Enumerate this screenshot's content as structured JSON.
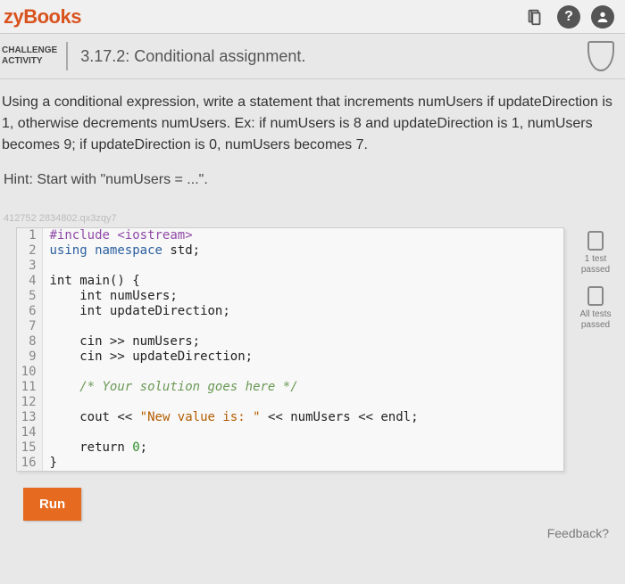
{
  "brand": "zyBooks",
  "header": {
    "challenge_label_line1": "CHALLENGE",
    "challenge_label_line2": "ACTIVITY",
    "title": "3.17.2: Conditional assignment."
  },
  "instructions": "Using a conditional expression, write a statement that increments numUsers if updateDirection is 1, otherwise decrements numUsers. Ex: if numUsers is 8 and updateDirection is 1, numUsers becomes 9; if updateDirection is 0, numUsers becomes 7.",
  "hint": "Hint: Start with \"numUsers = ...\".",
  "qid": "412752 2834802.qx3zqy7",
  "code": {
    "lines": [
      {
        "n": "1",
        "t": "#include <iostream>",
        "cls": "pp"
      },
      {
        "n": "2",
        "t_pre": "using namespace ",
        "t_mid": "std",
        "t_post": ";"
      },
      {
        "n": "3",
        "t": ""
      },
      {
        "n": "4",
        "t": "int main() {"
      },
      {
        "n": "5",
        "t": "    int numUsers;"
      },
      {
        "n": "6",
        "t": "    int updateDirection;"
      },
      {
        "n": "7",
        "t": ""
      },
      {
        "n": "8",
        "t": "    cin >> numUsers;"
      },
      {
        "n": "9",
        "t": "    cin >> updateDirection;"
      },
      {
        "n": "10",
        "t": ""
      },
      {
        "n": "11",
        "t": "    /* Your solution goes here */",
        "cls": "cm"
      },
      {
        "n": "12",
        "t": ""
      },
      {
        "n": "13",
        "t_pre": "    cout << ",
        "t_str": "\"New value is: \"",
        "t_post": " << numUsers << endl;"
      },
      {
        "n": "14",
        "t": ""
      },
      {
        "n": "15",
        "t_pre": "    return ",
        "t_num": "0",
        "t_post": ";"
      },
      {
        "n": "16",
        "t": "}"
      }
    ]
  },
  "status": {
    "one_test": "1 test passed",
    "all_tests": "All tests passed"
  },
  "buttons": {
    "run": "Run",
    "feedback": "Feedback?"
  }
}
